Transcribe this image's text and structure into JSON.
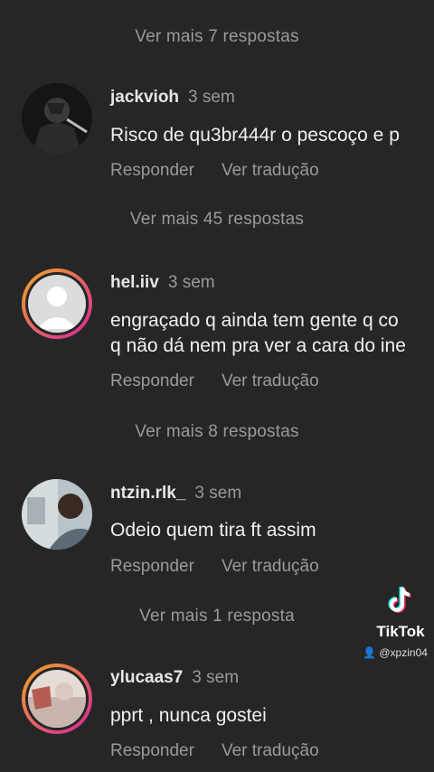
{
  "threads": [
    {
      "more_replies": "Ver mais 7 respostas"
    },
    {
      "username": "jackvioh",
      "time": "3 sem",
      "text": [
        "Risco de qu3br444r o pescoço e p"
      ],
      "reply_label": "Responder",
      "translate_label": "Ver tradução",
      "more_replies": "Ver mais 45 respostas"
    },
    {
      "username": "hel.iiv",
      "time": "3 sem",
      "text": [
        "engraçado q ainda tem gente q co",
        "q não dá nem pra ver a cara do ine"
      ],
      "reply_label": "Responder",
      "translate_label": "Ver tradução",
      "more_replies": "Ver mais 8 respostas"
    },
    {
      "username": "ntzin.rlk_",
      "time": "3 sem",
      "text": [
        "Odeio quem tira ft assim"
      ],
      "reply_label": "Responder",
      "translate_label": "Ver tradução",
      "more_replies": "Ver mais 1 resposta"
    },
    {
      "username": "ylucaas7",
      "time": "3 sem",
      "text": [
        "pprt , nunca gostei"
      ],
      "reply_label": "Responder",
      "translate_label": "Ver tradução"
    }
  ],
  "watermark": {
    "brand": "TikTok",
    "handle": "@xpzin04",
    "icon": "tiktok-logo-icon"
  },
  "colors": {
    "background": "#262626",
    "secondary_text": "#9a9a9a",
    "story_ring_start": "#f5a623",
    "story_ring_end": "#d6249f"
  }
}
